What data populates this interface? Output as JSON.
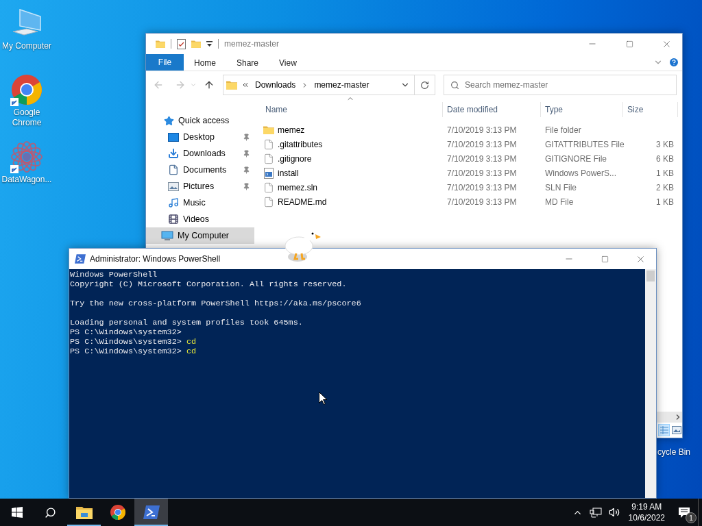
{
  "desktop_icons": [
    {
      "kind": "computer",
      "label": "My Computer",
      "shortcut": false
    },
    {
      "kind": "chrome",
      "label": "Google Chrome",
      "shortcut": true
    },
    {
      "kind": "datawagon",
      "label": "DataWagon...",
      "shortcut": true
    }
  ],
  "recycle_bin": {
    "label": "cycle Bin"
  },
  "explorer": {
    "title": "memez-master",
    "file_tab": "File",
    "tabs": [
      {
        "label": "Home",
        "selected": false
      },
      {
        "label": "Share",
        "selected": false
      },
      {
        "label": "View",
        "selected": false
      }
    ],
    "address": [
      "Downloads",
      "memez-master"
    ],
    "search": {
      "placeholder": "Search memez-master"
    },
    "nav": [
      {
        "kind": "quick",
        "label": "Quick access",
        "selected": false,
        "children": [
          {
            "kind": "desktop",
            "label": "Desktop",
            "pinned": true,
            "selected": false
          },
          {
            "kind": "downloads",
            "label": "Downloads",
            "pinned": true,
            "selected": false
          },
          {
            "kind": "documents",
            "label": "Documents",
            "pinned": true,
            "selected": false
          },
          {
            "kind": "pictures",
            "label": "Pictures",
            "pinned": true,
            "selected": false
          },
          {
            "kind": "music",
            "label": "Music",
            "pinned": false,
            "selected": false
          },
          {
            "kind": "videos",
            "label": "Videos",
            "pinned": false,
            "selected": false
          }
        ]
      },
      {
        "kind": "computer",
        "label": "My Computer",
        "selected": true
      }
    ],
    "columns": [
      {
        "label": "Name",
        "sorted": true
      },
      {
        "label": "Date modified",
        "sorted": false
      },
      {
        "label": "Type",
        "sorted": false
      },
      {
        "label": "Size",
        "sorted": false
      }
    ],
    "rows": [
      {
        "kind": "folder",
        "name": "memez",
        "date": "7/10/2019 3:13 PM",
        "type": "File folder"
      },
      {
        "kind": "file",
        "name": ".gitattributes",
        "date": "7/10/2019 3:13 PM",
        "type": "GITATTRIBUTES File",
        "size": "3 KB"
      },
      {
        "kind": "file",
        "name": ".gitignore",
        "date": "7/10/2019 3:13 PM",
        "type": "GITIGNORE File",
        "size": "6 KB"
      },
      {
        "kind": "script",
        "name": "install",
        "date": "7/10/2019 3:13 PM",
        "type": "Windows PowerS...",
        "size": "1 KB"
      },
      {
        "kind": "file",
        "name": "memez.sln",
        "date": "7/10/2019 3:13 PM",
        "type": "SLN File",
        "size": "2 KB"
      },
      {
        "kind": "file",
        "name": "README.md",
        "date": "7/10/2019 3:13 PM",
        "type": "MD File",
        "size": "1 KB"
      }
    ],
    "view_modes": [
      {
        "kind": "details",
        "selected": true
      },
      {
        "kind": "large",
        "selected": false
      }
    ]
  },
  "powershell": {
    "title": "Administrator: Windows PowerShell",
    "lines": [
      {
        "kind": "output",
        "text": "Windows PowerShell"
      },
      {
        "kind": "output",
        "text": "Copyright (C) Microsoft Corporation. All rights reserved."
      },
      {
        "kind": "blank"
      },
      {
        "kind": "output",
        "text": "Try the new cross-platform PowerShell https://aka.ms/pscore6"
      },
      {
        "kind": "blank"
      },
      {
        "kind": "output",
        "text": "Loading personal and system profiles took 645ms."
      },
      {
        "kind": "prompt",
        "text": "PS C:\\Windows\\system32>"
      },
      {
        "kind": "prompt",
        "text": "PS C:\\Windows\\system32>",
        "command": "cd"
      },
      {
        "kind": "prompt",
        "text": "PS C:\\Windows\\system32>",
        "command": "cd"
      }
    ]
  },
  "taskbar": {
    "apps": [
      {
        "kind": "explorer",
        "running": true,
        "active": false
      },
      {
        "kind": "chrome",
        "running": false,
        "active": false
      },
      {
        "kind": "powershell",
        "running": true,
        "active": true
      }
    ],
    "time": "9:19 AM",
    "date": "10/6/2022",
    "notifications": "1"
  }
}
